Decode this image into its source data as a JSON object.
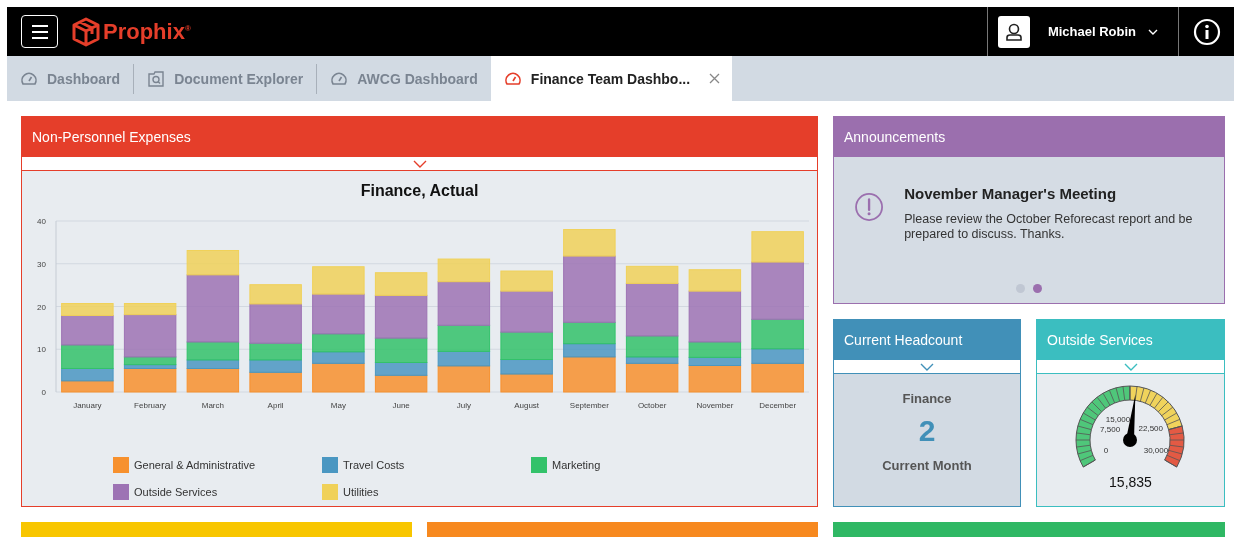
{
  "brand": {
    "name": "Prophix",
    "mark": "®"
  },
  "user": {
    "name": "Michael Robin"
  },
  "tabs": [
    {
      "label": "Dashboard",
      "kind": "dashboard",
      "selected": false
    },
    {
      "label": "Document Explorer",
      "kind": "explorer",
      "selected": false
    },
    {
      "label": "AWCG Dashboard",
      "kind": "dashboard",
      "selected": false
    },
    {
      "label": "Finance Team Dashbo...",
      "kind": "dashboard",
      "selected": true
    }
  ],
  "expenses": {
    "title": "Non-Personnel Expenses",
    "color": "#e53e2a",
    "chart_data": {
      "type": "bar",
      "stacked": true,
      "grid": true,
      "title": "Finance, Actual",
      "categories": [
        "January",
        "February",
        "March",
        "April",
        "May",
        "June",
        "July",
        "August",
        "September",
        "October",
        "November",
        "December"
      ],
      "ylim": [
        0,
        40
      ],
      "yticks": [
        0,
        10,
        20,
        30,
        40
      ],
      "series": [
        {
          "name": "General & Administrative",
          "color": "#f7912e",
          "values": [
            2.6,
            5.5,
            5.5,
            4.6,
            6.7,
            3.9,
            6.1,
            4.2,
            8.2,
            6.7,
            6.2,
            6.7
          ]
        },
        {
          "name": "Travel Costs",
          "color": "#4a97c2",
          "values": [
            2.9,
            0.9,
            2.0,
            2.9,
            2.7,
            3.0,
            3.4,
            3.4,
            3.1,
            1.5,
            1.9,
            3.4
          ]
        },
        {
          "name": "Marketing",
          "color": "#33c26a",
          "values": [
            5.5,
            1.8,
            4.2,
            3.9,
            4.2,
            5.7,
            6.1,
            6.4,
            5.0,
            4.9,
            3.6,
            6.9
          ]
        },
        {
          "name": "Outside Services",
          "color": "#9d73b4",
          "values": [
            6.9,
            9.9,
            15.7,
            9.2,
            9.3,
            10.0,
            10.2,
            9.6,
            15.5,
            12.3,
            11.9,
            13.4
          ]
        },
        {
          "name": "Utilities",
          "color": "#f0d159",
          "values": [
            2.8,
            2.6,
            5.7,
            4.5,
            6.4,
            5.3,
            5.3,
            4.7,
            6.2,
            4.0,
            5.0,
            7.1
          ]
        }
      ]
    }
  },
  "announcements": {
    "title": "Announcements",
    "color": "#9b6fae",
    "item": {
      "title": "November Manager's Meeting",
      "body": "Please review the October Reforecast report and be prepared to discuss. Thanks."
    },
    "dots": [
      {
        "selected": false
      },
      {
        "selected": true
      }
    ]
  },
  "headcount": {
    "title": "Current Headcount",
    "color": "#4190b8",
    "label": "Finance",
    "value": "2",
    "period": "Current Month"
  },
  "outside_services": {
    "title": "Outside Services",
    "color": "#3bbec0",
    "gauge": {
      "level": 0.528,
      "labels": [
        "0",
        "7,500",
        "15,000",
        "22,500",
        "30,000"
      ],
      "reading": "15,835"
    }
  },
  "bottom_panels": [
    {
      "color": "#f8c600"
    },
    {
      "color": "#f7891f"
    },
    {
      "color": "#2fb864"
    }
  ]
}
